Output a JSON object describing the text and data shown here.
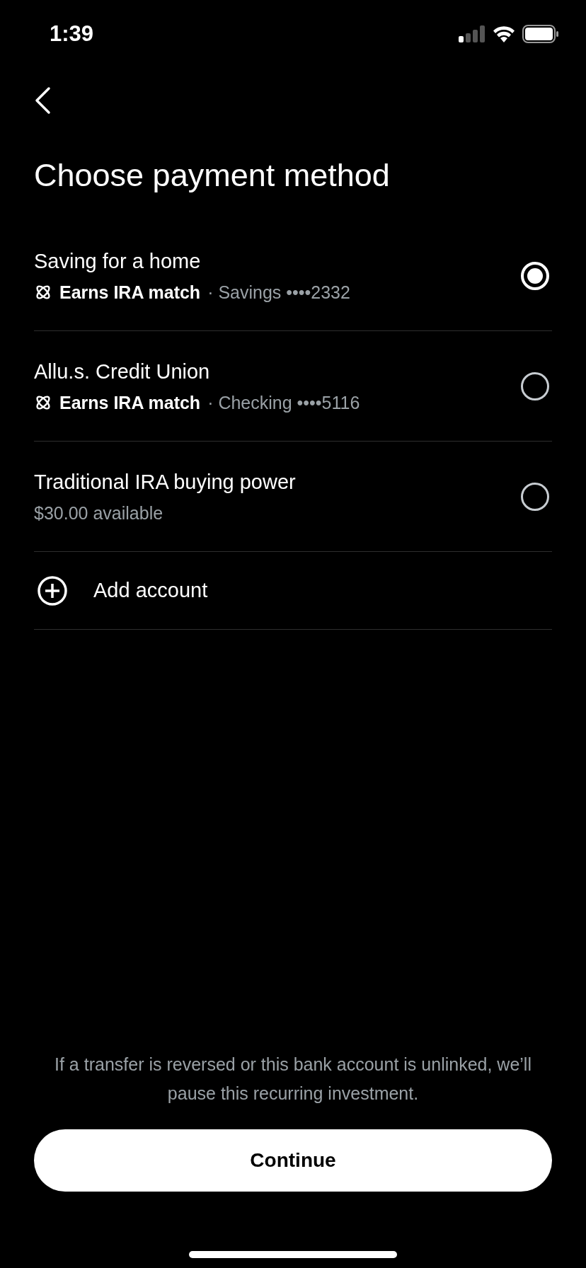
{
  "status_bar": {
    "time": "1:39"
  },
  "title": "Choose payment method",
  "accounts": [
    {
      "kind": "ira_match",
      "name": "Saving for a home",
      "badge": "Earns IRA match",
      "detail": "· Savings ••••2332",
      "selected": true
    },
    {
      "kind": "ira_match",
      "name": "Allu.s. Credit Union",
      "badge": "Earns IRA match",
      "detail": "· Checking ••••5116",
      "selected": false
    },
    {
      "kind": "plain",
      "name": "Traditional IRA buying power",
      "detail": "$30.00 available",
      "selected": false
    }
  ],
  "add_account": {
    "label": "Add account"
  },
  "footer_note": "If a transfer is reversed or this bank account is unlinked, we’ll pause this recurring investment.",
  "continue_button": {
    "label": "Continue"
  }
}
